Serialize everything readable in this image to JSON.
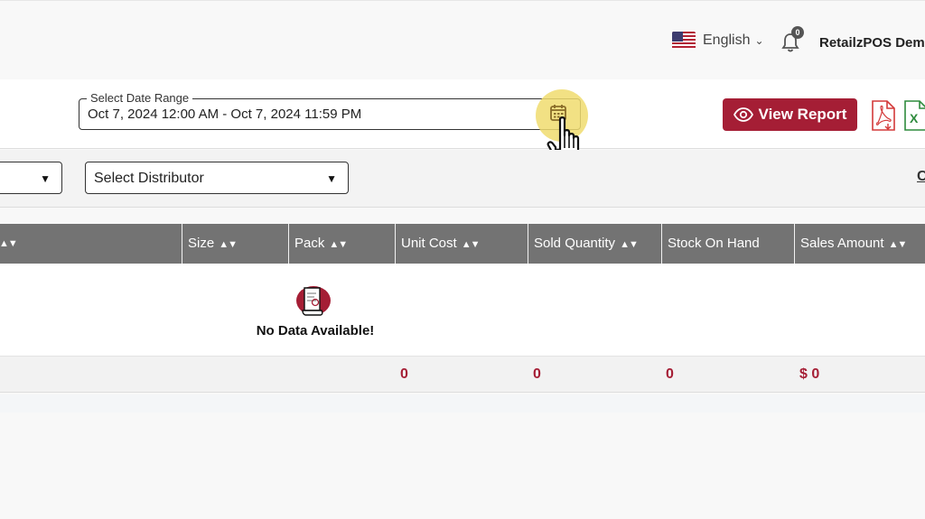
{
  "header": {
    "language": "English",
    "language_flag": "us-flag-icon",
    "notification_count": "0",
    "user_name": "RetailzPOS Dem"
  },
  "filters": {
    "date_range_label": "Select Date Range",
    "date_range_value": "Oct 7, 2024 12:00 AM - Oct 7, 2024 11:59 PM",
    "view_report_label": "View Report",
    "distributor_placeholder": "Select Distributor",
    "clear_link": "C"
  },
  "table": {
    "columns": [
      {
        "label": "",
        "sortable": true
      },
      {
        "label": "Size",
        "sortable": true
      },
      {
        "label": "Pack",
        "sortable": true
      },
      {
        "label": "Unit Cost",
        "sortable": true
      },
      {
        "label": "Sold Quantity",
        "sortable": true
      },
      {
        "label": "Stock On Hand",
        "sortable": false
      },
      {
        "label": "Sales Amount",
        "sortable": true
      }
    ],
    "empty_message": "No Data Available!",
    "totals": {
      "unit_cost": "0",
      "sold_quantity": "0",
      "stock_on_hand": "0",
      "sales_amount": "$ 0"
    }
  },
  "colors": {
    "accent": "#a51e35",
    "header_bg": "#737373",
    "highlight": "#f0dc6e"
  }
}
